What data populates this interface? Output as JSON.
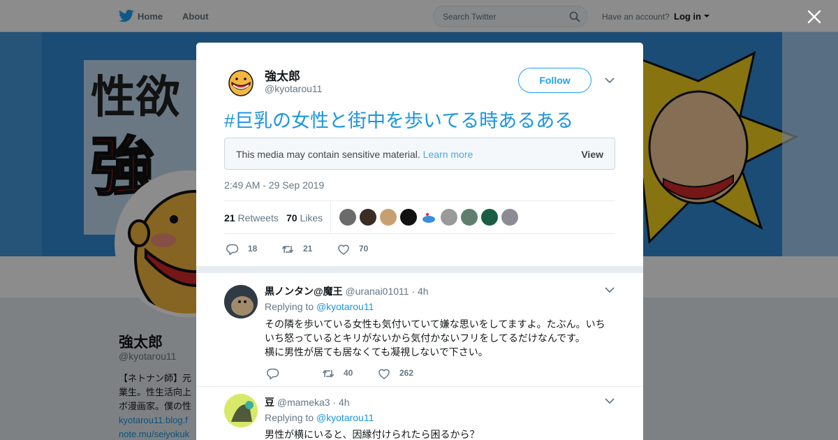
{
  "nav": {
    "home": "Home",
    "about": "About",
    "search_placeholder": "Search Twitter",
    "have_account": "Have an account?",
    "login": "Log in"
  },
  "profile": {
    "name": "強太郎",
    "handle": "@kyotarou11",
    "bio_lines": [
      "【ネトナン師】元",
      "業生。性生活向上",
      "ボ漫画家。僕の性"
    ],
    "links": [
      "kyotarou11.blog.f",
      "note.mu/seiyokuk"
    ]
  },
  "tweet": {
    "author_name": "強太郎",
    "author_handle": "@kyotarou11",
    "follow_label": "Follow",
    "text": "#巨乳の女性と街中を歩いてる時あるある",
    "sensitive_text": "This media may contain sensitive material.",
    "learn_more": "Learn more",
    "view_label": "View",
    "timestamp": "2:49 AM - 29 Sep 2019",
    "retweets_count": "21",
    "retweets_label": "Retweets",
    "likes_count": "70",
    "likes_label": "Likes",
    "action_replies": "18",
    "action_retweets": "21",
    "action_likes": "70"
  },
  "replies": [
    {
      "name": "黒ノンタン@魔王",
      "handle": "@uranai01011",
      "time": "· 4h",
      "replying_prefix": "Replying to",
      "replying_to": "@kyotarou11",
      "body_lines": [
        "その隣を歩いている女性も気付いていて嫌な思いをしてますよ。たぶん。いち",
        "いち怒っているとキリがないから気付かないフリをしてるだけなんです。",
        "横に男性が居ても居なくても凝視しないで下さい。"
      ],
      "retweets": "40",
      "likes": "262"
    },
    {
      "name": "豆",
      "handle": "@mameka3",
      "time": "· 4h",
      "replying_prefix": "Replying to",
      "replying_to": "@kyotarou11",
      "body_lines": [
        "男性が横にいると、因縁付けられたら困るから？"
      ]
    }
  ],
  "colors": {
    "accent": "#1da1f2",
    "link": "#1b95e0",
    "banner": "#2b86d4",
    "page_bg": "#e6ecf0"
  },
  "icons": [
    "twitter-bird-icon",
    "search-icon",
    "close-icon",
    "chevron-down-icon",
    "reply-icon",
    "retweet-icon",
    "like-icon"
  ]
}
